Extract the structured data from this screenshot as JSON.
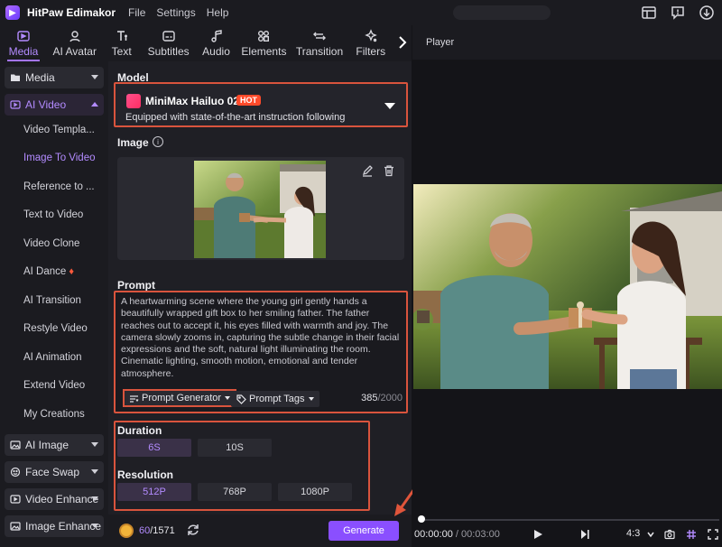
{
  "app": {
    "name": "HitPaw Edimakor",
    "menu": [
      "File",
      "Settings",
      "Help"
    ]
  },
  "tooltabs": [
    {
      "label": "Media",
      "icon": "media-icon",
      "active": true
    },
    {
      "label": "AI Avatar",
      "icon": "avatar-icon"
    },
    {
      "label": "Text",
      "icon": "text-icon"
    },
    {
      "label": "Subtitles",
      "icon": "subtitles-icon"
    },
    {
      "label": "Audio",
      "icon": "music-icon"
    },
    {
      "label": "Elements",
      "icon": "elements-icon"
    },
    {
      "label": "Transition",
      "icon": "transition-icon"
    },
    {
      "label": "Filters",
      "icon": "filters-icon"
    }
  ],
  "sidebar": {
    "media": "Media",
    "ai_video": "AI Video",
    "items": [
      "Video Templa...",
      "Image To Video",
      "Reference to ...",
      "Text to Video",
      "Video Clone",
      "AI Dance",
      "AI Transition",
      "Restyle Video",
      "AI Animation",
      "Extend Video",
      "My Creations"
    ],
    "ai_image": "AI Image",
    "face_swap": "Face Swap",
    "video_enhance": "Video Enhance",
    "image_enhance": "Image Enhance"
  },
  "model": {
    "section": "Model",
    "name": "MiniMax Hailuo 02",
    "badge": "HOT",
    "description": "Equipped with state-of-the-art instruction following"
  },
  "image": {
    "section": "Image"
  },
  "prompt": {
    "section": "Prompt",
    "text": "A heartwarming scene where the young girl gently hands a beautifully wrapped gift box to her smiling father. The father reaches out to accept it, his eyes filled with warmth and joy. The camera slowly zooms in, capturing the subtle change in their facial expressions and the soft, natural light illuminating the room. Cinematic lighting, smooth motion, emotional and tender atmosphere.",
    "generator_label": "Prompt Generator",
    "tags_label": "Prompt Tags",
    "count": "385",
    "max": "/2000"
  },
  "duration": {
    "section": "Duration",
    "options": [
      "6S",
      "10S"
    ],
    "selected": "6S"
  },
  "resolution": {
    "section": "Resolution",
    "options": [
      "512P",
      "768P",
      "1080P"
    ],
    "selected": "512P"
  },
  "footer": {
    "credits_used": "60",
    "credits_total": "/1571",
    "generate_label": "Generate"
  },
  "player": {
    "title": "Player",
    "current_time": "00:00:00",
    "separator": "/",
    "total_time": "00:03:00",
    "aspect": "4:3"
  }
}
